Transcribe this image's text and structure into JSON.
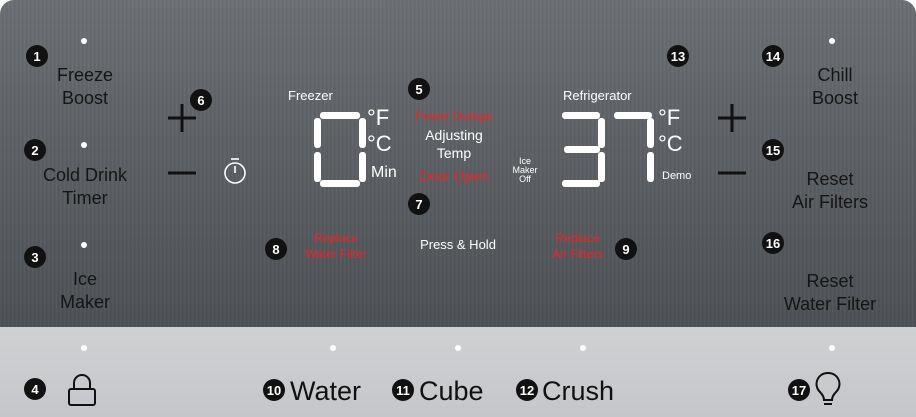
{
  "controls": {
    "freeze_boost": {
      "num": "1",
      "line1": "Freeze",
      "line2": "Boost"
    },
    "cold_drink_timer": {
      "num": "2",
      "line1": "Cold Drink",
      "line2": "Timer"
    },
    "ice_maker": {
      "num": "3",
      "line1": "Ice",
      "line2": "Maker"
    },
    "lock": {
      "num": "4"
    },
    "power_outage_marker": {
      "num": "5"
    },
    "timer_plus_marker": {
      "num": "6"
    },
    "door_open_marker": {
      "num": "7"
    },
    "replace_water_filter": {
      "num": "8",
      "line1": "Replace",
      "line2": "Water Filter"
    },
    "replace_air_filters": {
      "num": "9",
      "line1": "Replace",
      "line2": "Air Filters"
    },
    "water": {
      "num": "10",
      "label": "Water"
    },
    "cube": {
      "num": "11",
      "label": "Cube"
    },
    "crush": {
      "num": "12",
      "label": "Crush"
    },
    "demo_marker": {
      "num": "13"
    },
    "chill_boost": {
      "num": "14",
      "line1": "Chill",
      "line2": "Boost"
    },
    "reset_air_filters": {
      "num": "15",
      "line1": "Reset",
      "line2": "Air Filters"
    },
    "reset_water_filter": {
      "num": "16",
      "line1": "Reset",
      "line2": "Water Filter"
    },
    "light": {
      "num": "17"
    }
  },
  "display": {
    "freezer_label": "Freezer",
    "freezer_value": "0",
    "refrigerator_label": "Refrigerator",
    "refrigerator_value": "37",
    "unit_f": "°F",
    "unit_c": "°C",
    "min": "Min",
    "demo": "Demo",
    "power_outage": "Power Outage",
    "adjusting_temp_1": "Adjusting",
    "adjusting_temp_2": "Temp",
    "door_open": "Door Open",
    "press_hold": "Press & Hold",
    "ice_maker_off_1": "Ice",
    "ice_maker_off_2": "Maker",
    "ice_maker_off_3": "Off"
  },
  "colors": {
    "indicator_red": "#e8262a",
    "panel": "#5f6266",
    "bottom_strip": "#c8cacc"
  },
  "icons": [
    "plus-icon",
    "minus-icon",
    "stopwatch-icon",
    "lock-icon",
    "lightbulb-icon"
  ]
}
